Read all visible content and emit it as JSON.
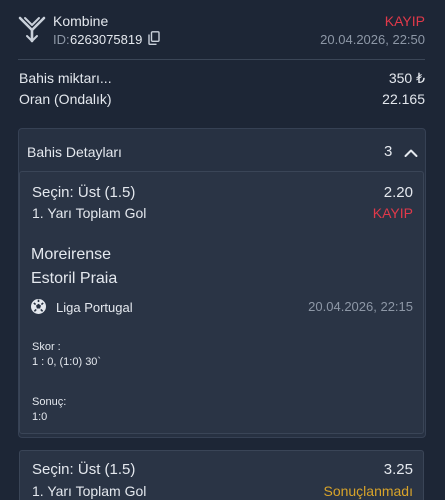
{
  "header": {
    "title": "Kombine",
    "id_label": "ID:",
    "id_value": "6263075819",
    "status": "KAYIP",
    "datetime": "20.04.2026, 22:50"
  },
  "summary": {
    "stake_label": "Bahis miktarı...",
    "stake_value": "350 ₺",
    "odds_label": "Oran (Ondalık)",
    "odds_value": "22.165"
  },
  "details": {
    "title": "Bahis Detayları",
    "count": "3",
    "expanded": true
  },
  "bets": [
    {
      "selection": "Seçin: Üst (1.5)",
      "market": "1. Yarı Toplam Gol",
      "odds": "2.20",
      "status": "KAYIP",
      "home_team": "Moreirense",
      "away_team": "Estoril Praia",
      "league": "Liga Portugal",
      "event_datetime": "20.04.2026, 22:15",
      "score_label": "Skor :",
      "score_value": "1 : 0, (1:0) 30`",
      "result_label": "Sonuç:",
      "result_value": "1:0"
    },
    {
      "selection": "Seçin: Üst (1.5)",
      "market": "1. Yarı Toplam Gol",
      "odds": "3.25",
      "status": "Sonuçlanmadı"
    }
  ],
  "colors": {
    "background": "#1d2636",
    "lost": "#e0394a",
    "pending": "#d7a32a"
  },
  "icons": {
    "logo": "y-branch-logo-icon",
    "copy": "copy-icon",
    "collapse": "chevron-up-icon",
    "sport": "soccer-ball-icon"
  }
}
